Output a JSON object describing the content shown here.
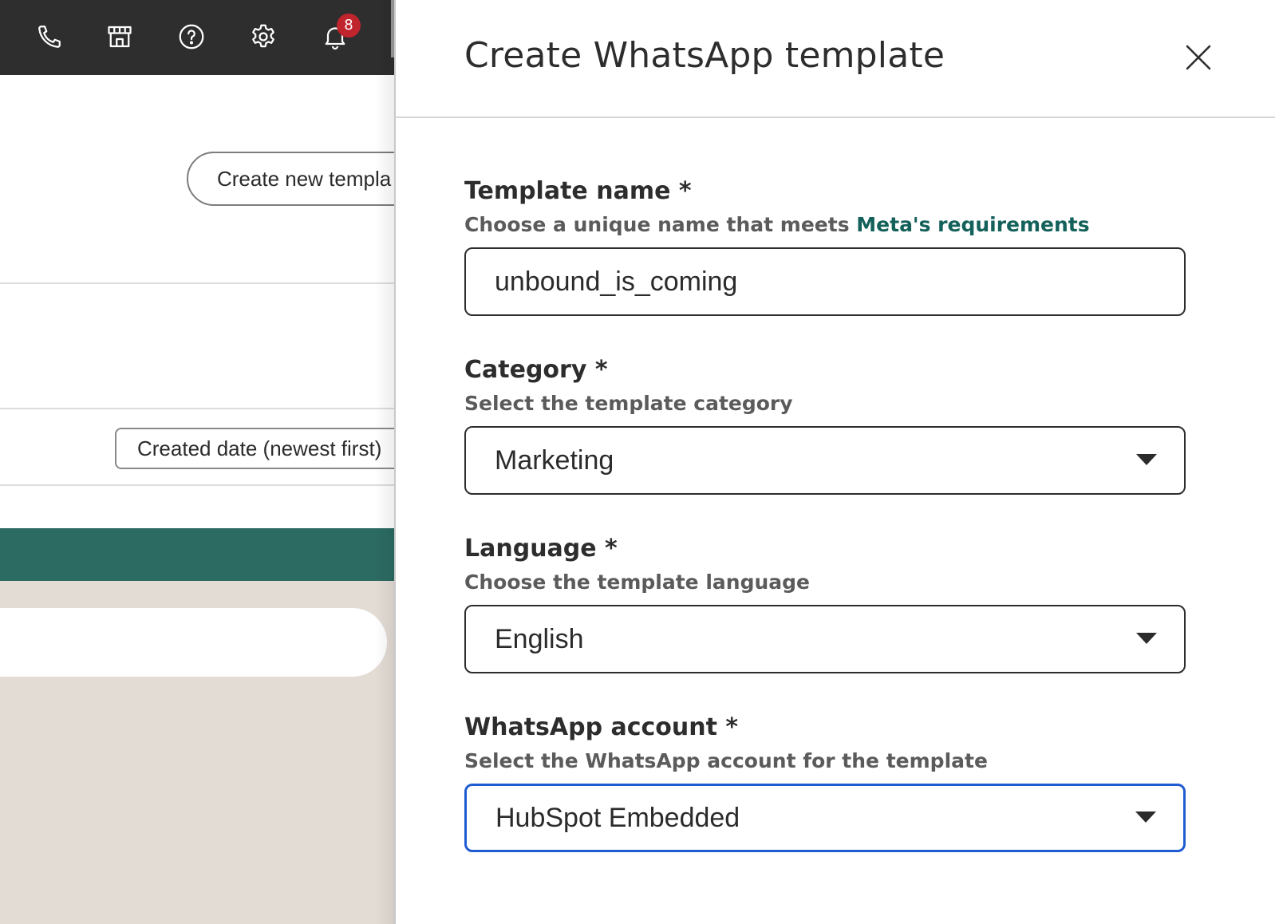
{
  "topbar": {
    "icons": [
      "phone-icon",
      "store-icon",
      "help-icon",
      "settings-icon",
      "bell-icon"
    ],
    "notification_count": "8"
  },
  "background": {
    "create_new_label": "Create new templa",
    "sort_label": "Created date (newest first)"
  },
  "panel": {
    "title": "Create WhatsApp template",
    "fields": {
      "template_name": {
        "label": "Template name *",
        "help_prefix": "Choose a unique name that meets ",
        "help_link": "Meta's requirements",
        "value": "unbound_is_coming"
      },
      "category": {
        "label": "Category *",
        "help": "Select the template category",
        "value": "Marketing"
      },
      "language": {
        "label": "Language *",
        "help": "Choose the template language",
        "value": "English"
      },
      "whatsapp_account": {
        "label": "WhatsApp account *",
        "help": "Select the WhatsApp account for the template",
        "value": "HubSpot Embedded"
      }
    }
  },
  "colors": {
    "topbar": "#2e2e2e",
    "accent_teal": "#2c6b62",
    "link": "#14605a",
    "focus_blue": "#1f5bd1",
    "badge": "#c0242c"
  }
}
